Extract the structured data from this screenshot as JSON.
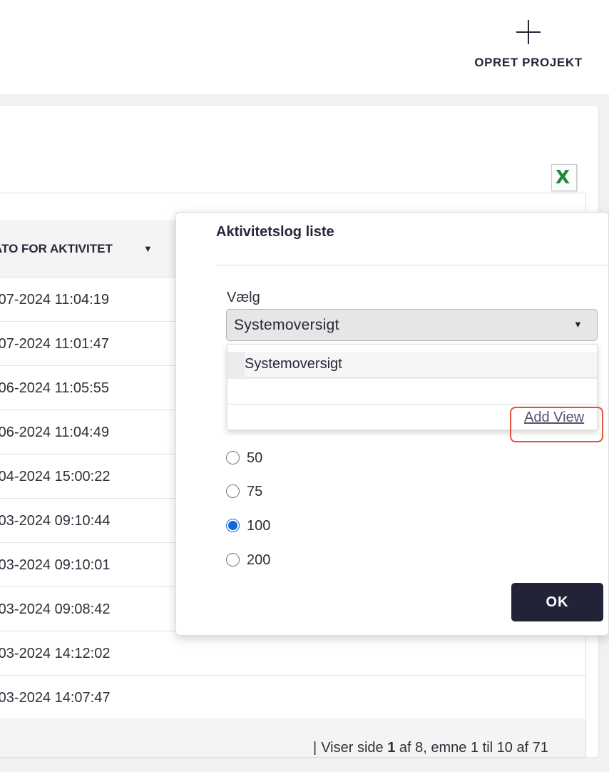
{
  "header": {
    "create_project_label": "OPRET PROJEKT"
  },
  "table": {
    "column_header": "ATO FOR AKTIVITET",
    "rows": [
      "-07-2024 11:04:19",
      "-07-2024 11:01:47",
      "-06-2024 11:05:55",
      "-06-2024 11:04:49",
      "-04-2024 15:00:22",
      "-03-2024 09:10:44",
      "-03-2024 09:10:01",
      "-03-2024 09:08:42",
      "-03-2024 14:12:02",
      "-03-2024 14:07:47"
    ],
    "pager": {
      "prefix": "Viser side",
      "page": "1",
      "suffix": "af 8, emne 1 til 10 af 71"
    }
  },
  "popup": {
    "title": "Aktivitetslog liste",
    "select_label": "Vælg",
    "select_value": "Systemoversigt",
    "dropdown": {
      "options": [
        "Systemoversigt"
      ],
      "add_view_label": "Add View"
    },
    "page_size_options": [
      {
        "label": "50",
        "checked": false
      },
      {
        "label": "75",
        "checked": false
      },
      {
        "label": "100",
        "checked": true
      },
      {
        "label": "200",
        "checked": false
      }
    ],
    "ok_label": "OK"
  },
  "colors": {
    "primary_dark": "#232338",
    "radio_selected": "#1468d9",
    "highlight": "#e0533f",
    "excel_green": "#1f8a36"
  },
  "icons": {
    "create": "plus-icon",
    "export": "excel-icon",
    "settings": "gear-icon",
    "sort": "sort-down-icon",
    "select": "chevron-down-icon"
  }
}
